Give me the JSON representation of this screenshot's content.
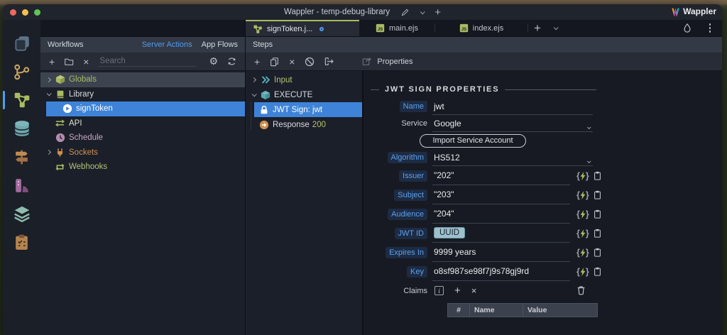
{
  "colors": {
    "selection_blue": "#3e83d8",
    "link_blue": "#4f9cf0",
    "label_blue": "#5ba1ec",
    "accent_green": "#a9bb61",
    "teal": "#5ba8b0",
    "orange": "#cf8f4e",
    "purple": "#b48bb0",
    "tag_bg": "#9cc0cc",
    "panel_bg": "#1b1f29",
    "header_bg": "#333945"
  },
  "titlebar": {
    "title": "Wappler - temp-debug-library",
    "logo_text": "Wappler"
  },
  "sidebar": {
    "items": [
      {
        "icon": "pages-icon"
      },
      {
        "icon": "git-branch-icon"
      },
      {
        "icon": "workflows-icon",
        "active": true
      },
      {
        "icon": "database-icon"
      },
      {
        "icon": "routes-icon"
      },
      {
        "icon": "styles-icon"
      },
      {
        "icon": "layers-icon"
      },
      {
        "icon": "tasks-icon"
      }
    ]
  },
  "editor_tabs": {
    "tabs": [
      {
        "label": "signToken.j...",
        "icon": "workflow-icon",
        "active": true,
        "modified": true
      },
      {
        "label": "main.ejs",
        "icon": "js-icon"
      },
      {
        "label": "index.ejs",
        "icon": "js-icon"
      }
    ]
  },
  "workflows": {
    "title": "Workflows",
    "mode_tabs": [
      {
        "label": "Server Actions",
        "active": true
      },
      {
        "label": "App Flows",
        "active": false
      }
    ],
    "search_placeholder": "Search",
    "tree": [
      {
        "label": "Globals",
        "icon": "cube-icon"
      },
      {
        "label": "Library",
        "icon": "book-icon"
      },
      {
        "label": "signToken",
        "icon": "play-icon",
        "selected": true
      },
      {
        "label": "API",
        "icon": "swap-arrows-icon"
      },
      {
        "label": "Schedule",
        "icon": "clock-icon"
      },
      {
        "label": "Sockets",
        "icon": "plug-icon"
      },
      {
        "label": "Webhooks",
        "icon": "repeat-icon"
      }
    ]
  },
  "steps": {
    "title": "Steps",
    "tree": [
      {
        "label": "Input",
        "icon": "double-chevron-icon"
      },
      {
        "label": "EXECUTE",
        "icon": "cube-icon"
      },
      {
        "label": "JWT Sign: jwt",
        "icon": "lock-icon",
        "selected": true
      },
      {
        "label": "Response",
        "icon": "response-arrow-icon",
        "badge": "200"
      }
    ]
  },
  "properties": {
    "panel_title": "Properties",
    "section_title": "JWT SIGN PROPERTIES",
    "name": {
      "label": "Name",
      "value": "jwt"
    },
    "service": {
      "label": "Service",
      "value": "Google"
    },
    "import_button": "Import Service Account",
    "algorithm": {
      "label": "Algorithm",
      "value": "HS512"
    },
    "issuer": {
      "label": "Issuer",
      "value": "\"202\""
    },
    "subject": {
      "label": "Subject",
      "value": "\"203\""
    },
    "audience": {
      "label": "Audience",
      "value": "\"204\""
    },
    "jwt_id": {
      "label": "JWT ID",
      "value": "UUID"
    },
    "expires_in": {
      "label": "Expires In",
      "value": "9999 years"
    },
    "key": {
      "label": "Key",
      "value": "o8sf987se98f7j9s78gj9rd"
    },
    "claims": {
      "label": "Claims",
      "table_headers": [
        "#",
        "Name",
        "Value"
      ]
    }
  }
}
